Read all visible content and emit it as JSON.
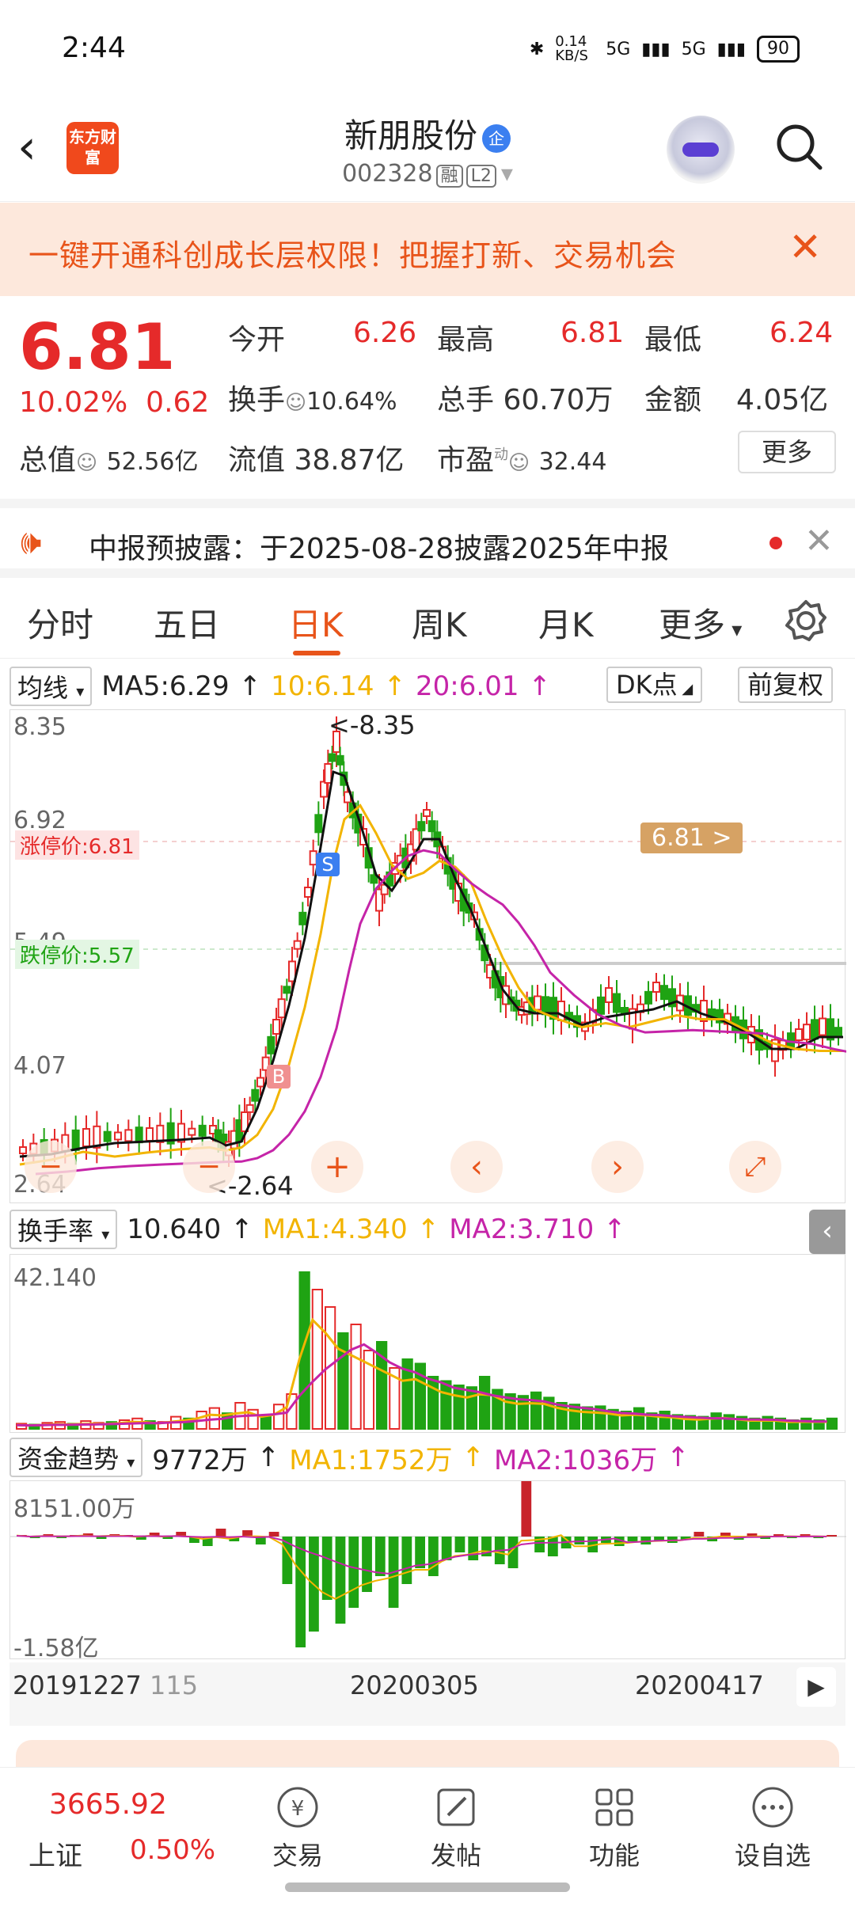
{
  "status_bar": {
    "time": "2:44",
    "net": "0.14 KB/S",
    "sig1": "5G",
    "sig2": "5G",
    "battery": "90"
  },
  "header": {
    "stock_name": "新朋股份",
    "corp_badge": "企",
    "code": "002328",
    "margin_tag": "融",
    "level_tag": "L2",
    "brand": "东方财富"
  },
  "banner": {
    "text": "一键开通科创成长层权限！把握打新、交易机会"
  },
  "quote": {
    "price": "6.81",
    "pct": "10.02%",
    "change": "0.62",
    "open_label": "今开",
    "open": "6.26",
    "high_label": "最高",
    "high": "6.81",
    "low_label": "最低",
    "low": "6.24",
    "turnover_label": "换手",
    "turnover": "10.64%",
    "volume_label": "总手",
    "volume": "60.70万",
    "amount_label": "金额",
    "amount": "4.05亿",
    "mktcap_label": "总值",
    "mktcap": "52.56亿",
    "float_label": "流值",
    "float_cap": "38.87亿",
    "pe_label": "市盈",
    "pe_sup": "动",
    "pe": "32.44",
    "more": "更多"
  },
  "notice": {
    "text": "中报预披露：于2025-08-28披露2025年中报"
  },
  "tabs": [
    "分时",
    "五日",
    "日K",
    "周K",
    "月K",
    "更多"
  ],
  "kline": {
    "ma_label": "均线",
    "ma5": "MA5:6.29",
    "ma10": "10:6.14",
    "ma20": "20:6.01",
    "dk": "DK点",
    "adjust": "前复权",
    "y_top": "8.35",
    "y_mid": "6.92",
    "y_mid2": "5.49",
    "y_low": "4.07",
    "y_bottom": "2.64",
    "peak_label": "<-8.35",
    "low_label": "<-2.64",
    "limit_up": "涨停价:6.81",
    "limit_down": "跌停价:5.57",
    "price_tag": "6.81 >",
    "buy_mark": "B",
    "sell_mark": "S"
  },
  "turnover_panel": {
    "label": "换手率",
    "value": "10.640",
    "ma1": "MA1:4.340",
    "ma2": "MA2:3.710",
    "y_top": "42.140"
  },
  "fund_panel": {
    "label": "资金趋势",
    "value": "9772万",
    "ma1": "MA1:1752万",
    "ma2": "MA2:1036万",
    "y_top": "8151.00万",
    "y_bottom": "-1.58亿"
  },
  "x_axis": {
    "d1": "20191227",
    "d1b": "115",
    "d2": "20200305",
    "d3": "20200417"
  },
  "bottom": {
    "index_value": "3665.92",
    "index_name": "上证",
    "index_pct": "0.50%",
    "trade": "交易",
    "post": "发帖",
    "func": "功能",
    "watch": "设自选"
  },
  "colors": {
    "up": "#e52a2a",
    "down": "#1fa313",
    "ma5": "#111111",
    "ma10": "#f2b400",
    "ma20": "#c524a8",
    "accent": "#e8541a"
  }
}
